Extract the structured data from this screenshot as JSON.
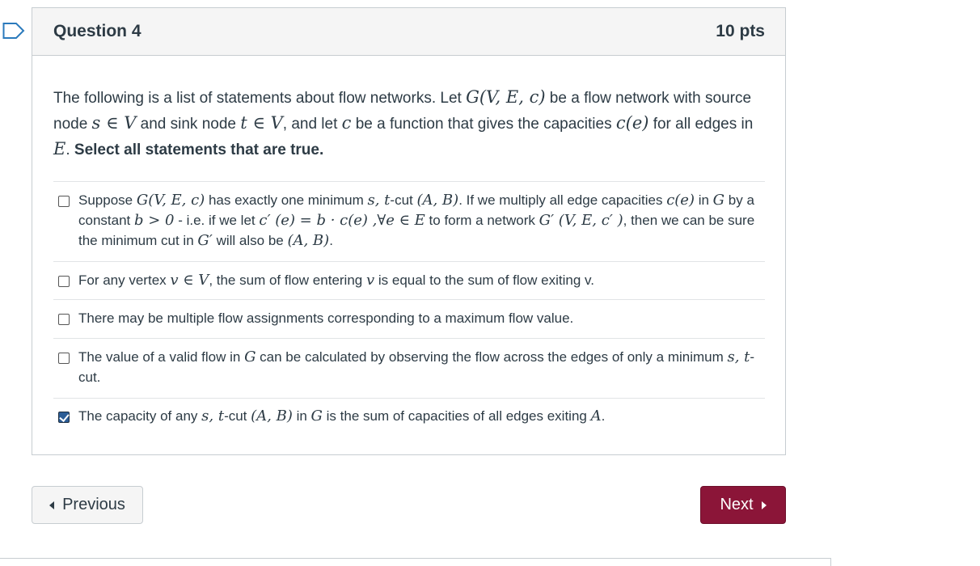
{
  "question": {
    "title": "Question 4",
    "points": "10 pts",
    "text": {
      "t1": "The following is a list of statements about flow networks. Let ",
      "m1": "G(V, E, c)",
      "t2": " be a flow network with source node ",
      "m2": "s ∈ V",
      "t3": " and sink node ",
      "m3": "t ∈ V",
      "t4": ", and let ",
      "m4": "c",
      "t5": " be a function that gives the capacities ",
      "m5": "c(e)",
      "t6": " for all edges in ",
      "m6": "E",
      "t7": ". ",
      "bold": "Select all statements that are true."
    }
  },
  "answers": [
    {
      "checked": false,
      "parts": {
        "t1": "Suppose ",
        "m1": "G(V, E, c)",
        "t2": " has exactly one minimum ",
        "m2": "s, t",
        "t3": "-cut ",
        "m3": "(A, B)",
        "t4": ". If we multiply all edge capacities  ",
        "m4": "c(e)",
        "t5": " in ",
        "m5": "G",
        "t6": " by a constant ",
        "m6": "b > 0",
        "t7": " - i.e. if we let ",
        "m7": "c′ (e) = b · c(e) ,∀e ∈ E",
        "t8": " to form a network ",
        "m8": "G′ (V, E, c′ )",
        "t9": ", then we can be sure the minimum cut in ",
        "m9": "G′",
        "t10": " will also be ",
        "m10": "(A, B)",
        "t11": "."
      }
    },
    {
      "checked": false,
      "parts": {
        "t1": "For any vertex ",
        "m1": "v ∈ V",
        "t2": ", the sum of flow entering ",
        "m2": "v",
        "t3": " is equal to the sum of flow exiting v."
      }
    },
    {
      "checked": false,
      "parts": {
        "t1": "There may be multiple flow assignments corresponding to a maximum flow value."
      }
    },
    {
      "checked": false,
      "parts": {
        "t1": "The value of a valid flow in ",
        "m1": "G",
        "t2": " can be calculated by observing the flow across the edges of only a minimum ",
        "m2": "s, t",
        "t3": "-cut."
      }
    },
    {
      "checked": true,
      "parts": {
        "t1": "The capacity of any ",
        "m1": "s, t",
        "t2": "-cut ",
        "m2": "(A, B)",
        "t3": " in ",
        "m3": "G",
        "t4": " is the sum of capacities of all edges exiting ",
        "m4": "A",
        "t5": "."
      }
    }
  ],
  "nav": {
    "previous_label": "Previous",
    "next_label": "Next"
  },
  "colors": {
    "next_button": "#8b1538",
    "checkbox_checked": "#2b5c95",
    "header_bg": "#f5f5f5"
  },
  "icons": {
    "flag": "bookmark-flag-icon",
    "prev": "caret-left-icon",
    "next": "caret-right-icon"
  }
}
